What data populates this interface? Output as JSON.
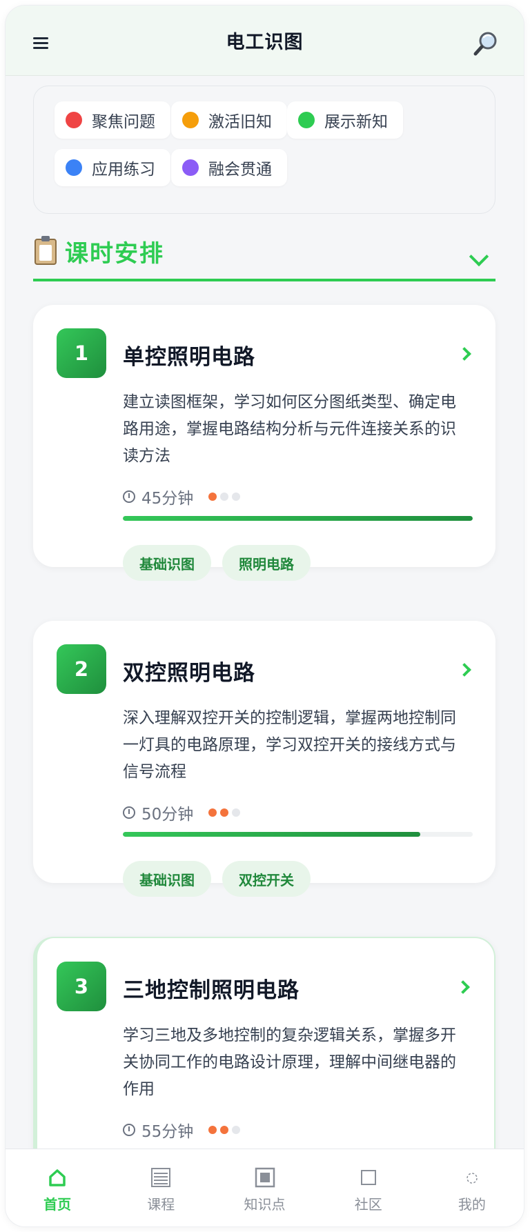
{
  "header": {
    "title": "电工识图"
  },
  "legend": [
    {
      "label": "聚焦问题",
      "color": "#ef4444"
    },
    {
      "label": "激活旧知",
      "color": "#f59e0b"
    },
    {
      "label": "展示新知",
      "color": "#2ecc52"
    },
    {
      "label": "应用练习",
      "color": "#3b82f6"
    },
    {
      "label": "融会贯通",
      "color": "#8b5cf6"
    }
  ],
  "section": {
    "title": "课时安排",
    "icon": "clipboard-icon"
  },
  "lessons": [
    {
      "number": "1",
      "title": "单控照明电路",
      "description": "建立读图框架，学习如何区分图纸类型、确定电路用途，掌握电路结构分析与元件连接关系的识读方法",
      "duration": "45分钟",
      "difficulty": 1,
      "progress": 1.0,
      "tags": [
        "基础识图",
        "照明电路"
      ]
    },
    {
      "number": "2",
      "title": "双控照明电路",
      "description": "深入理解双控开关的控制逻辑，掌握两地控制同一灯具的电路原理，学习双控开关的接线方式与信号流程",
      "duration": "50分钟",
      "difficulty": 2,
      "progress": 0.85,
      "tags": [
        "基础识图",
        "双控开关"
      ]
    },
    {
      "number": "3",
      "title": "三地控制照明电路",
      "description": "学习三地及多地控制的复杂逻辑关系，掌握多开关协同工作的电路设计原理，理解中间继电器的作用",
      "duration": "55分钟",
      "difficulty": 2
    }
  ],
  "nav": [
    {
      "label": "首页",
      "icon": "home-icon",
      "active": true
    },
    {
      "label": "课程",
      "icon": "course-icon"
    },
    {
      "label": "知识点",
      "icon": "knowledge-icon"
    },
    {
      "label": "社区",
      "icon": "community-icon"
    },
    {
      "label": "我的",
      "icon": "profile-icon"
    }
  ]
}
